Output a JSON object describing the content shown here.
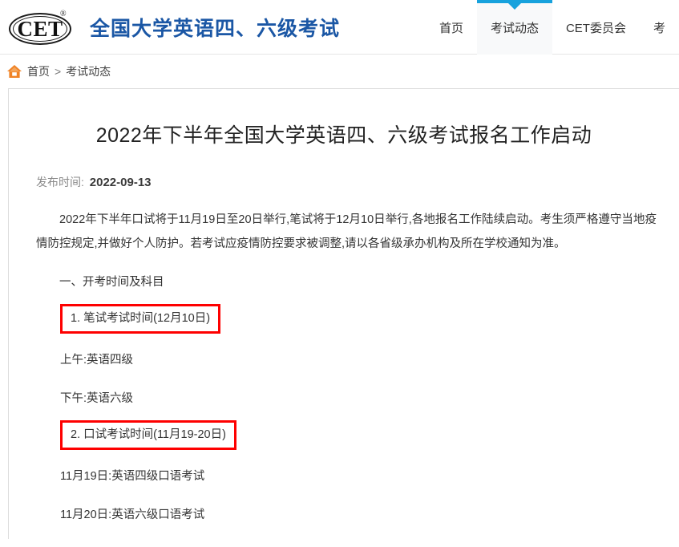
{
  "header": {
    "logo": {
      "text": "CET",
      "registered_mark": "®",
      "icon": "cet-oval-logo"
    },
    "brand_title": "全国大学英语四、六级考试",
    "nav_items": [
      {
        "label": "首页",
        "active": false
      },
      {
        "label": "考试动态",
        "active": true
      },
      {
        "label": "CET委员会",
        "active": false
      },
      {
        "label": "考",
        "active": false
      }
    ],
    "accent_color": "#17a2dd",
    "brand_color": "#1b57a5"
  },
  "breadcrumb": {
    "home_icon": "home-icon",
    "home_icon_color": "#f08326",
    "items": [
      "首页",
      "考试动态"
    ],
    "separator": ">"
  },
  "article": {
    "title": "2022年下半年全国大学英语四、六级考试报名工作启动",
    "publish_label": "发布时间:",
    "publish_date": "2022-09-13",
    "paragraph": "2022年下半年口试将于11月19日至20日举行,笔试将于12月10日举行,各地报名工作陆续启动。考生须严格遵守当地疫情防控规定,并做好个人防护。若考试应疫情防控要求被调整,请以各省级承办机构及所在学校通知为准。",
    "section_heading": "一、开考时间及科目",
    "items": [
      {
        "type": "boxed",
        "text": "1. 笔试考试时间(12月10日)"
      },
      {
        "type": "line",
        "text": "上午:英语四级"
      },
      {
        "type": "line",
        "text": "下午:英语六级"
      },
      {
        "type": "boxed",
        "text": "2. 口试考试时间(11月19-20日)"
      },
      {
        "type": "line",
        "text": "11月19日:英语四级口语考试"
      },
      {
        "type": "line",
        "text": "11月20日:英语六级口语考试"
      }
    ],
    "highlight_color": "#fe0000"
  }
}
